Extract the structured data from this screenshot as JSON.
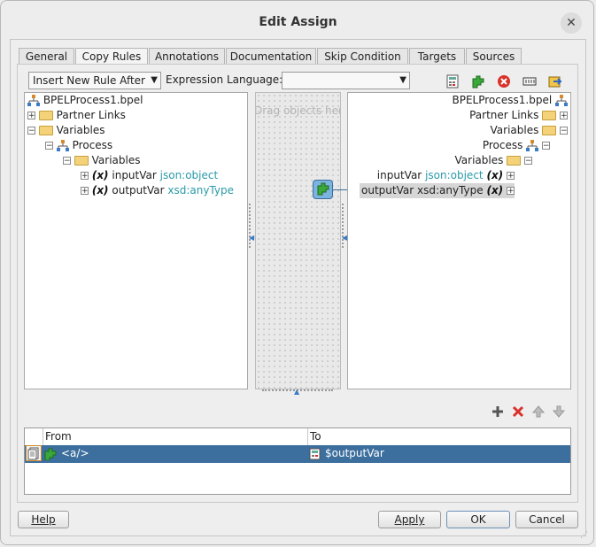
{
  "dialog": {
    "title": "Edit Assign",
    "close_glyph": "✕"
  },
  "tabs": [
    {
      "label": "General"
    },
    {
      "label": "Copy Rules",
      "active": true
    },
    {
      "label": "Annotations"
    },
    {
      "label": "Documentation"
    },
    {
      "label": "Skip Condition"
    },
    {
      "label": "Targets"
    },
    {
      "label": "Sources"
    }
  ],
  "toolbar": {
    "insert_mode": "Insert New Rule After",
    "expression_language_label": "Expression Language:",
    "expression_language_value": "",
    "icons": [
      "expression-builder-icon",
      "xml-fragment-icon",
      "delete-icon",
      "literal-icon",
      "copy-list-icon"
    ]
  },
  "source_tree": {
    "root": "BPELProcess1.bpel",
    "partner_links": "Partner Links",
    "variables": "Variables",
    "process": "Process",
    "process_variables": "Variables",
    "vars": [
      {
        "name": "inputVar",
        "type": "json:object"
      },
      {
        "name": "outputVar",
        "type": "xsd:anyType"
      }
    ]
  },
  "middle": {
    "hint": "Drag objects here"
  },
  "target_tree": {
    "root": "BPELProcess1.bpel",
    "partner_links": "Partner Links",
    "variables": "Variables",
    "process": "Process",
    "process_variables": "Variables",
    "vars": [
      {
        "name": "inputVar",
        "type": "json:object"
      },
      {
        "name": "outputVar xsd:anyType"
      }
    ]
  },
  "rules": {
    "columns": [
      "From",
      "To"
    ],
    "rows": [
      {
        "from": "<a/>",
        "to": "$outputVar"
      }
    ]
  },
  "buttons": {
    "help": "Help",
    "apply": "Apply",
    "ok": "OK",
    "cancel": "Cancel"
  },
  "colors": {
    "selection": "#3d6f9e",
    "type_text": "#2a9aa8",
    "link_line": "#3a6e9a"
  }
}
